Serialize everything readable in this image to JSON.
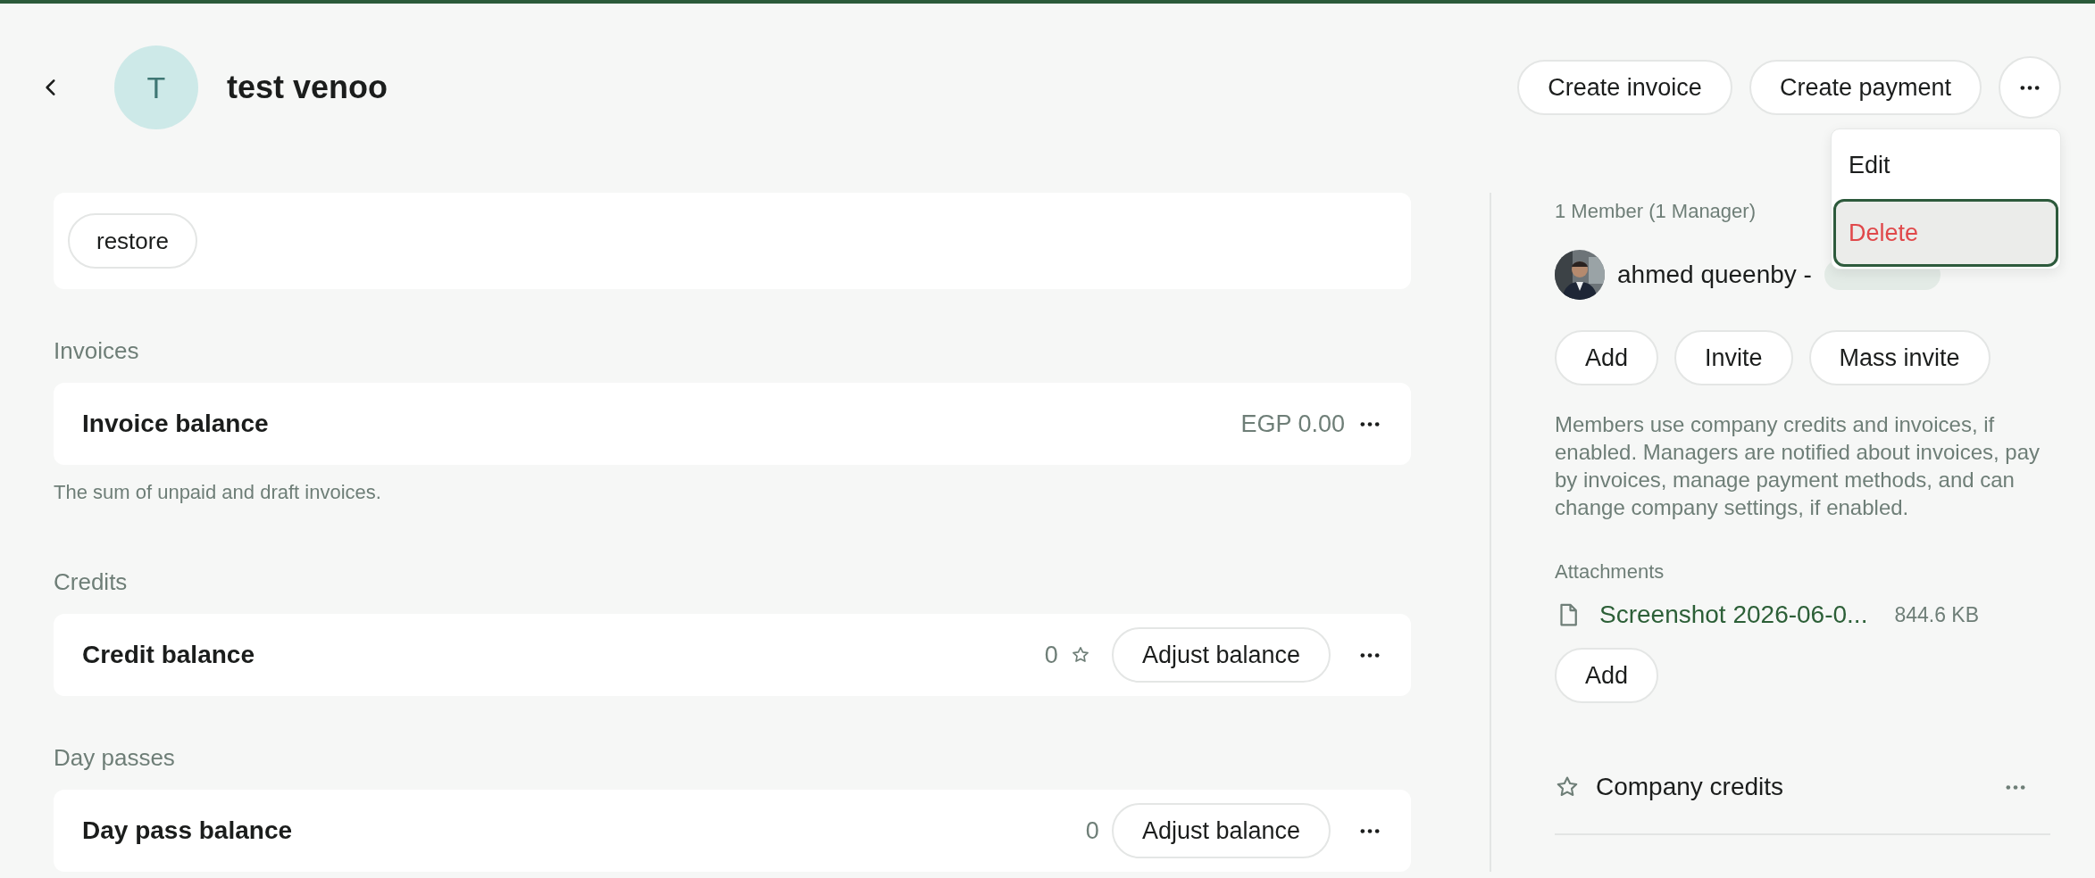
{
  "header": {
    "avatar_initial": "T",
    "title": "test venoo"
  },
  "actions": [
    {
      "label": "Create invoice"
    },
    {
      "label": "Create payment"
    }
  ],
  "menu": {
    "items": [
      {
        "label": "Edit",
        "kind": "normal",
        "selected": false
      },
      {
        "label": "Delete",
        "kind": "danger",
        "selected": true
      }
    ]
  },
  "restore_button": "restore",
  "sections": [
    {
      "heading": "Invoices",
      "label": "Invoice balance",
      "value": "EGP 0.00",
      "star": false,
      "note": "The sum of unpaid and draft invoices."
    },
    {
      "heading": "Credits",
      "label": "Credit balance",
      "value": "0",
      "star": true,
      "button": "Adjust balance"
    },
    {
      "heading": "Day passes",
      "label": "Day pass balance",
      "value": "0",
      "star": false,
      "button": "Adjust balance"
    }
  ],
  "members": {
    "summary": "1 Member (1 Manager)",
    "list": [
      {
        "name": "ahmed queenby -",
        "manager": true
      }
    ],
    "buttons": [
      "Add",
      "Invite",
      "Mass invite"
    ],
    "description": "Members use company credits and invoices, if enabled. Managers are notified about invoices, pay by invoices, manage payment methods, and can change company settings, if enabled."
  },
  "attachments": {
    "heading": "Attachments",
    "files": [
      {
        "name": "Screenshot 2026-06-0...",
        "size": "844.6 KB"
      }
    ],
    "add_button": "Add"
  },
  "side_items": [
    {
      "label": "Company credits",
      "kind": "credits"
    }
  ]
}
